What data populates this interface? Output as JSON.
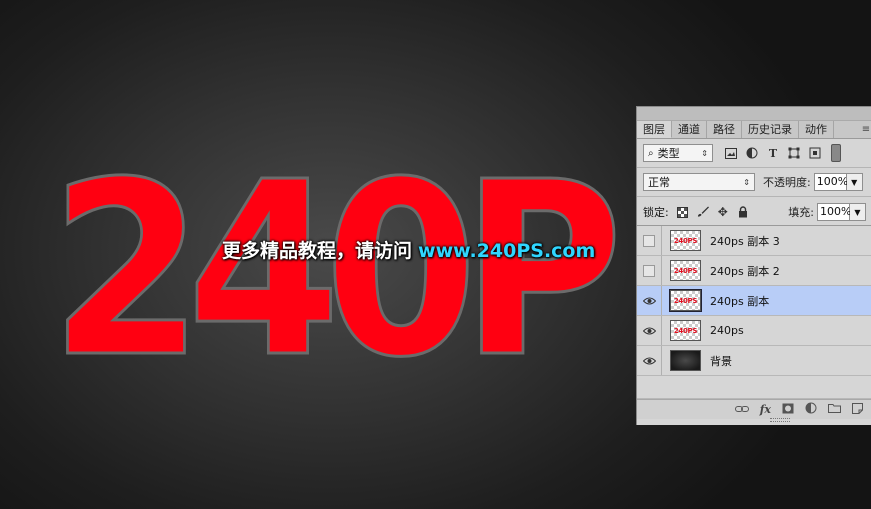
{
  "canvas": {
    "big_text": "240P",
    "watermark_cn": "更多精品教程，请访问",
    "watermark_url": "www.240PS.com"
  },
  "layers_panel": {
    "tabs": [
      {
        "label": "图层",
        "active": true
      },
      {
        "label": "通道",
        "active": false
      },
      {
        "label": "路径",
        "active": false
      },
      {
        "label": "历史记录",
        "active": false
      },
      {
        "label": "动作",
        "active": false
      }
    ],
    "filter": {
      "label": "类型"
    },
    "blend_mode": "正常",
    "opacity_label": "不透明度:",
    "opacity_value": "100%",
    "lock_label": "锁定:",
    "fill_label": "填充:",
    "fill_value": "100%",
    "thumb_text": "240PS",
    "layers": [
      {
        "name": "240ps  副本 3",
        "visible": false,
        "selected": false,
        "type": "text"
      },
      {
        "name": "240ps  副本 2",
        "visible": false,
        "selected": false,
        "type": "text"
      },
      {
        "name": "240ps  副本",
        "visible": true,
        "selected": true,
        "type": "text"
      },
      {
        "name": "240ps",
        "visible": true,
        "selected": false,
        "type": "text"
      },
      {
        "name": "背景",
        "visible": true,
        "selected": false,
        "type": "background"
      }
    ],
    "bottom_icons": [
      "link-icon",
      "fx-icon",
      "mask-icon",
      "adjustment-icon",
      "folder-icon",
      "new-layer-icon"
    ],
    "fx_label": "fx"
  },
  "colors": {
    "text_fill": "#ff0011",
    "text_stroke": "#6b6b6b",
    "watermark_url": "#2fd6ff",
    "selected_layer": "#b8cdf7"
  }
}
